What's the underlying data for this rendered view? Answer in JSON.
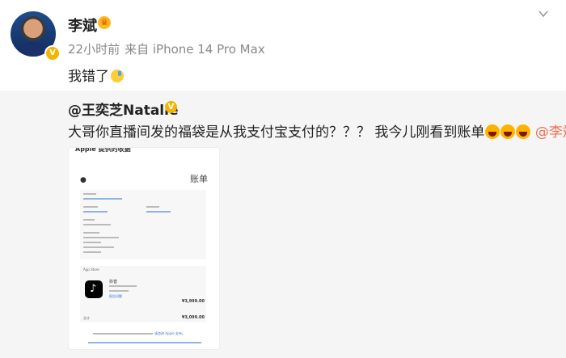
{
  "post": {
    "author": "李斌",
    "time": "22小时前",
    "source": "来自 iPhone 14 Pro Max",
    "text": "我错了"
  },
  "repost": {
    "author": "@王奕芝Natalie",
    "text": "大哥你直播间发的福袋是从我支付宝支付的？？？ 我今儿刚看到账单",
    "mention": "@李斌",
    "receipt": {
      "header": "Apple 提供的收据",
      "bill_label": "账单",
      "section": "App Store",
      "app_name": "抖音",
      "link": "报告问题",
      "item_price": "¥3,999.00",
      "total_label": "总计",
      "total": "¥3,099.00",
      "footer_link": "请咨询 Apple 支持。"
    }
  },
  "colors": {
    "mention": "#eb7350",
    "verified": "#f5b400",
    "meta": "#888888",
    "repost_bg": "#f5f5f5"
  },
  "icons": [
    "avatar",
    "verified-badge-icon",
    "crown-icon",
    "chevron-down-icon",
    "emoji-sweat-icon",
    "emoji-laugh-icon"
  ]
}
